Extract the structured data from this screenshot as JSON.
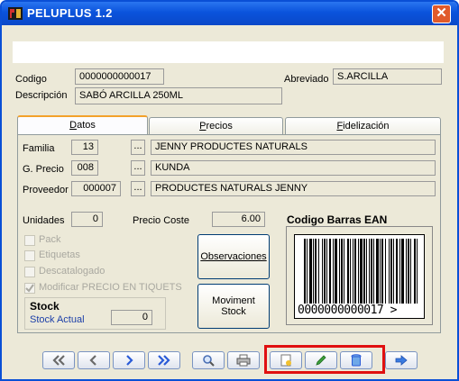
{
  "window": {
    "title": "PELUPLUS 1.2",
    "close_symbol": "✕"
  },
  "header": {
    "codigo_label": "Codigo",
    "codigo_value": "0000000000017",
    "abreviado_label": "Abreviado",
    "abreviado_value": "S.ARCILLA",
    "descripcion_label": "Descripción",
    "descripcion_value": "SABÓ ARCILLA 250ML"
  },
  "tabs": [
    {
      "label": "Datos",
      "accel": "D",
      "rest": "atos",
      "active": true
    },
    {
      "label": "Precios",
      "accel": "P",
      "rest": "recios",
      "active": false
    },
    {
      "label": "Fidelización",
      "accel": "F",
      "rest": "idelización",
      "active": false
    }
  ],
  "datos": {
    "familia_label": "Familia",
    "familia_code": "13",
    "familia_name": "JENNY PRODUCTES NATURALS",
    "gprecio_label": "G. Precio",
    "gprecio_code": "008",
    "gprecio_name": "KUNDA",
    "proveedor_label": "Proveedor",
    "proveedor_code": "000007",
    "proveedor_name": "PRODUCTES NATURALS JENNY",
    "ellipsis": "...",
    "unidades_label": "Unidades",
    "unidades_value": "0",
    "precio_coste_label": "Precio Coste",
    "precio_coste_value": "6.00",
    "checkboxes": [
      {
        "label": "Pack",
        "checked": false
      },
      {
        "label": "Etiquetas",
        "checked": false
      },
      {
        "label": "Descatalogado",
        "checked": false
      },
      {
        "label": "Modificar PRECIO EN TIQUETS",
        "checked": true
      }
    ],
    "stock_title": "Stock",
    "stock_actual_label": "Stock Actual",
    "stock_actual_value": "0",
    "observaciones_label": "Observaciones",
    "moviment_stock_label": "Moviment Stock",
    "barcode_title": "Codigo Barras EAN",
    "barcode_text": "0000000000017 >"
  },
  "toolbar": {
    "buttons": [
      {
        "name": "first-record-button",
        "icon": "double-left-arrow-icon"
      },
      {
        "name": "previous-record-button",
        "icon": "left-arrow-icon"
      },
      {
        "name": "next-record-button",
        "icon": "right-arrow-icon"
      },
      {
        "name": "last-record-button",
        "icon": "double-right-arrow-icon"
      },
      {
        "name": "search-button",
        "icon": "magnifier-icon"
      },
      {
        "name": "print-button",
        "icon": "printer-icon"
      },
      {
        "name": "new-record-button",
        "icon": "new-document-icon"
      },
      {
        "name": "edit-record-button",
        "icon": "pencil-icon"
      },
      {
        "name": "delete-record-button",
        "icon": "trash-can-icon"
      },
      {
        "name": "exit-button",
        "icon": "exit-arrow-icon"
      }
    ]
  },
  "colors": {
    "title_bar": "#0a53dc",
    "highlight": "#e01010",
    "arrow_blue": "#2a5bd7"
  }
}
